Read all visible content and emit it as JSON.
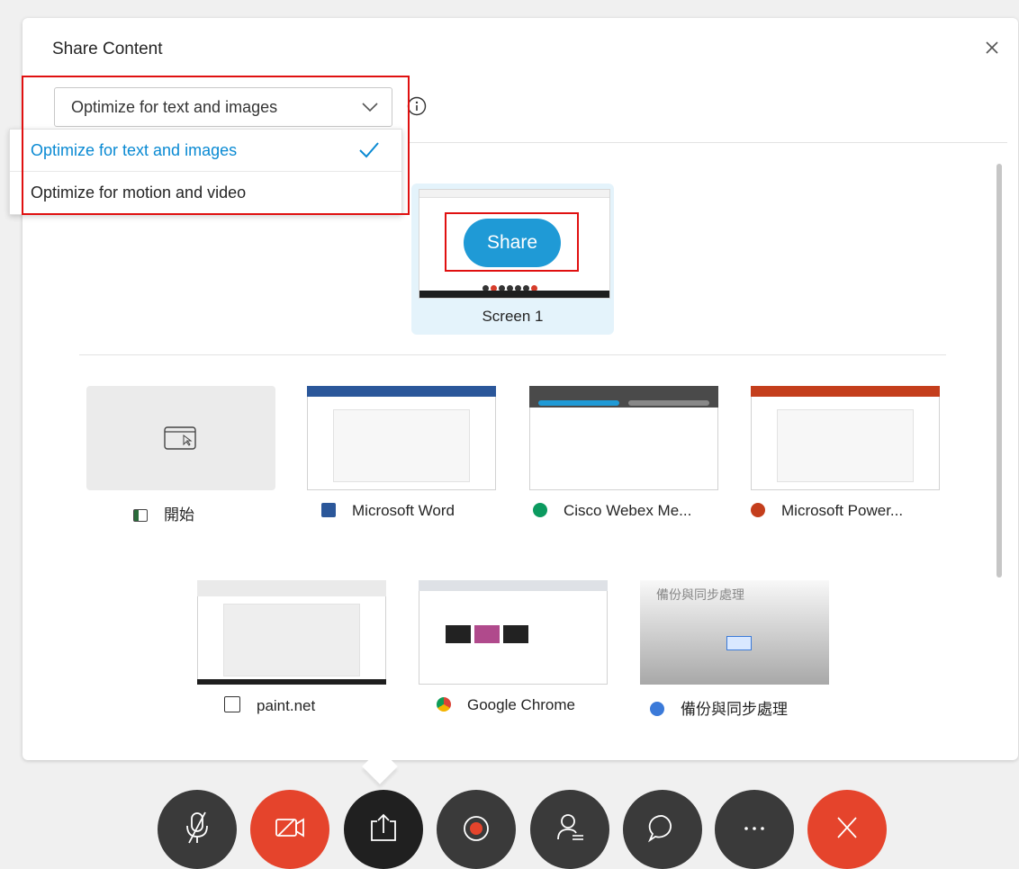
{
  "dialog": {
    "title": "Share Content",
    "close_icon": "close-icon",
    "optimize": {
      "selected": "Optimize for text and images",
      "options": [
        "Optimize for text and images",
        "Optimize for motion and video"
      ],
      "info_icon": "info-icon"
    }
  },
  "screens": [
    {
      "label": "Screen 1",
      "share_label": "Share"
    }
  ],
  "apps": [
    {
      "label": "開始",
      "icon": "window-icon"
    },
    {
      "label": "Microsoft Word",
      "icon": "word-icon"
    },
    {
      "label": "Cisco Webex Me...",
      "icon": "webex-icon"
    },
    {
      "label": "Microsoft Power...",
      "icon": "powerpoint-icon"
    },
    {
      "label": "paint.net",
      "icon": "paintnet-icon"
    },
    {
      "label": "Google Chrome",
      "icon": "chrome-icon"
    },
    {
      "label": "備份與同步處理",
      "icon": "backup-sync-icon"
    }
  ],
  "backup_thumb_title": "備份與同步處理",
  "toolbar": {
    "buttons": [
      "mute-icon",
      "video-off-icon",
      "share-icon",
      "record-icon",
      "participants-icon",
      "chat-icon",
      "more-icon",
      "leave-icon"
    ]
  },
  "colors": {
    "accent": "#1f9ad6",
    "selected_text": "#0a8ad3",
    "highlight": "#e01010",
    "danger": "#e5442c",
    "dark_button": "#3a3a3a"
  }
}
